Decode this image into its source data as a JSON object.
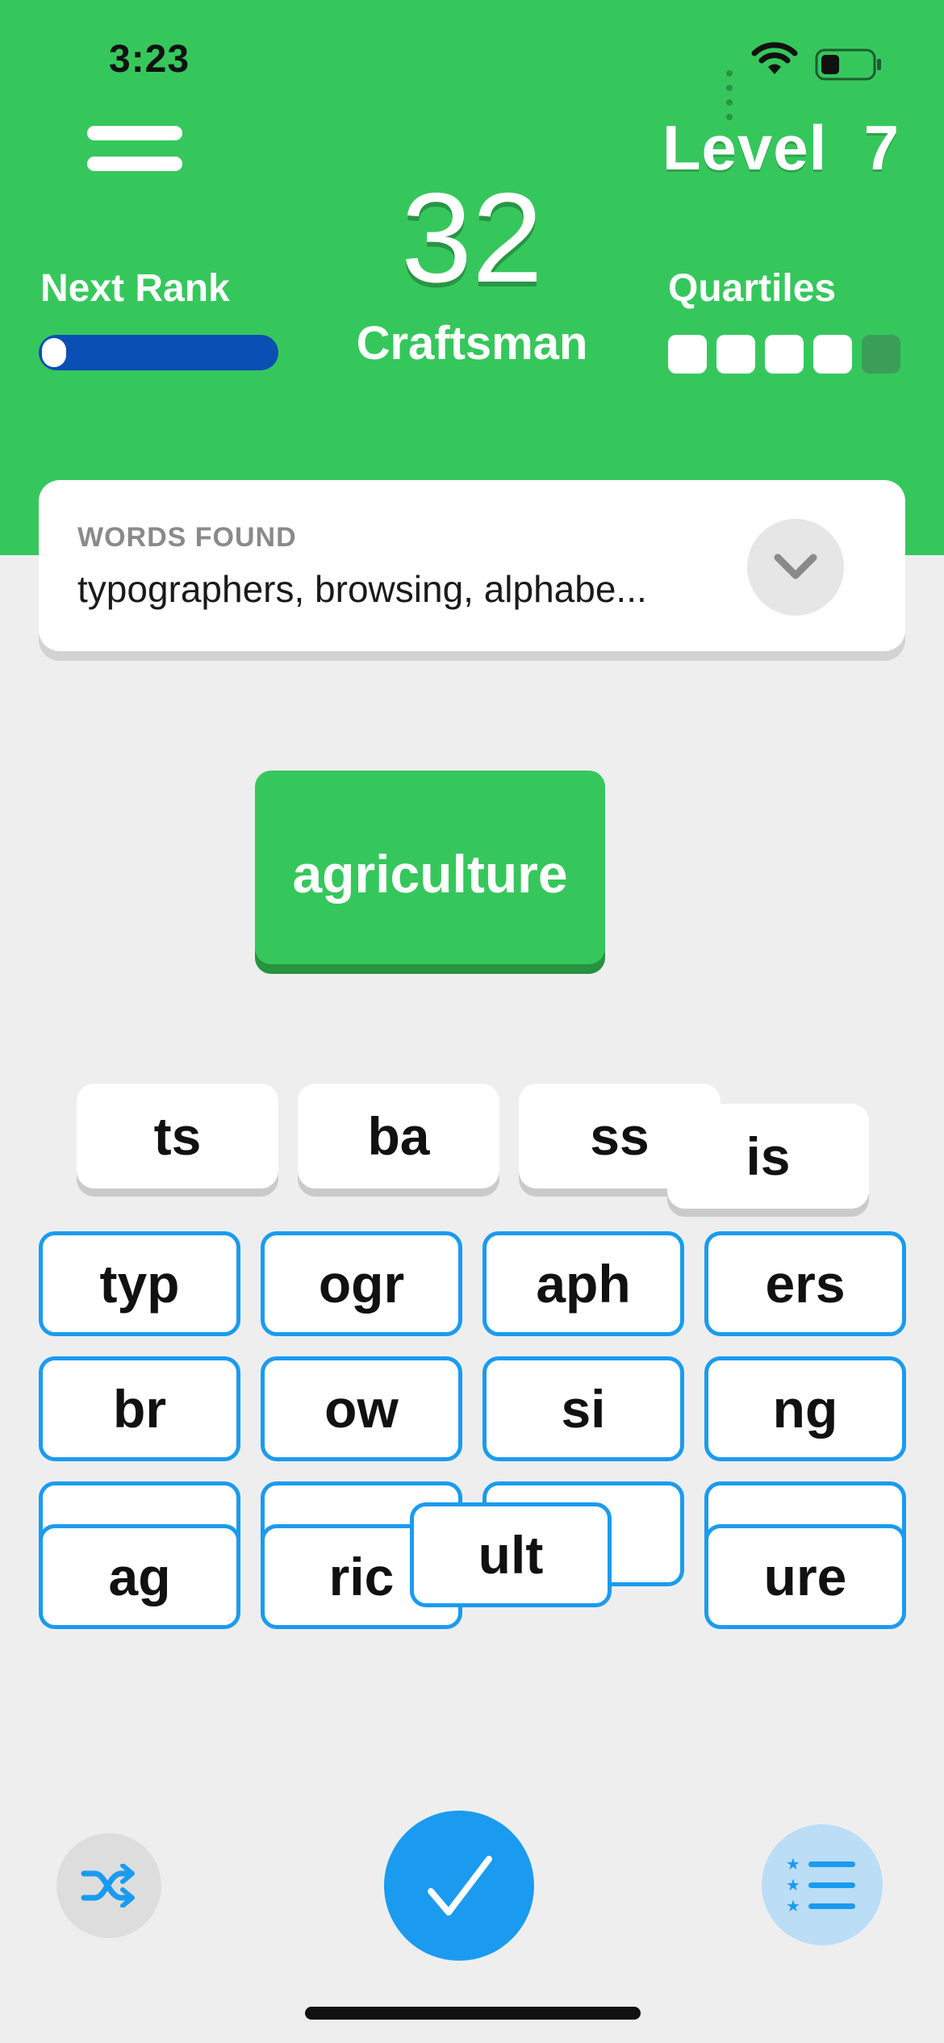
{
  "status_bar": {
    "time": "3:23",
    "icons": [
      "signal-icon",
      "wifi-icon",
      "battery-icon"
    ]
  },
  "header": {
    "menu_icon": "menu-icon",
    "level": "Level  7",
    "score": "32",
    "rank_name": "Craftsman",
    "next_rank_label": "Next Rank",
    "next_rank_progress": 0.06,
    "quartiles_label": "Quartiles",
    "quartiles_found": 4,
    "quartiles_total": 5,
    "background_color": "#36C75C",
    "progress_color": "#0A4FB4"
  },
  "words_found": {
    "label": "WORDS FOUND",
    "list": "typographers, browsing, alphabe...",
    "expand_icon": "chevron-down-icon"
  },
  "selected_word": "agriculture",
  "floating_tiles": [
    "ts",
    "ba",
    "ss",
    "is"
  ],
  "grid_tiles": [
    "typ",
    "ogr",
    "aph",
    "ers",
    "br",
    "ow",
    "si",
    "ng",
    "ag",
    "ric",
    "ult",
    "ure"
  ],
  "controls": {
    "shuffle_icon": "shuffle-icon",
    "submit_icon": "checkmark-icon",
    "list_icon": "ranked-list-icon"
  },
  "colors": {
    "accent_blue": "#1A9BF0",
    "green": "#36C75C",
    "background": "#EEEEEE"
  }
}
